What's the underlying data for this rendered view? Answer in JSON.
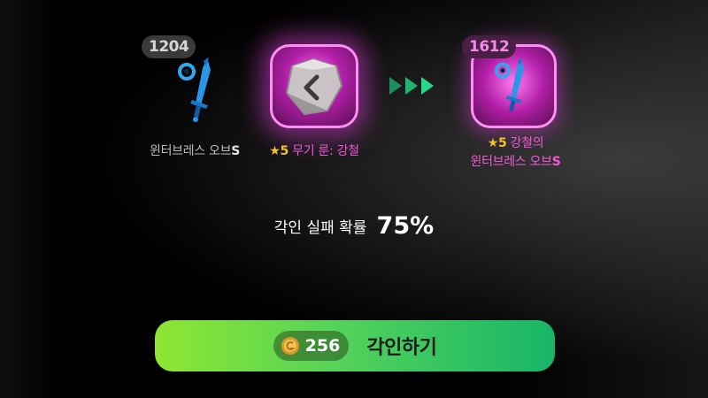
{
  "current_item": {
    "level": "1204",
    "name": "윈터브레스 오브",
    "tier": "S",
    "icon": "ice-sword-icon"
  },
  "rune": {
    "stars": "★5",
    "name": "무기 룬: 강철",
    "icon": "steel-rune-icon"
  },
  "result_item": {
    "level": "1612",
    "stars": "★5",
    "name_line1": "강철의",
    "name_line2": "윈터브레스 오브",
    "tier": "S",
    "icon": "ice-sword-icon"
  },
  "fail_chance": {
    "label": "각인 실패 확률",
    "value": "75%"
  },
  "engrave_button": {
    "cost": "256",
    "label": "각인하기",
    "currency_icon": "gold-coin-icon"
  },
  "colors": {
    "accent_pink": "#f05ad8",
    "button_green_start": "#8fe632",
    "button_green_end": "#17b569",
    "star_gold": "#f3c12a",
    "arrow_green": "#1fc27a"
  }
}
